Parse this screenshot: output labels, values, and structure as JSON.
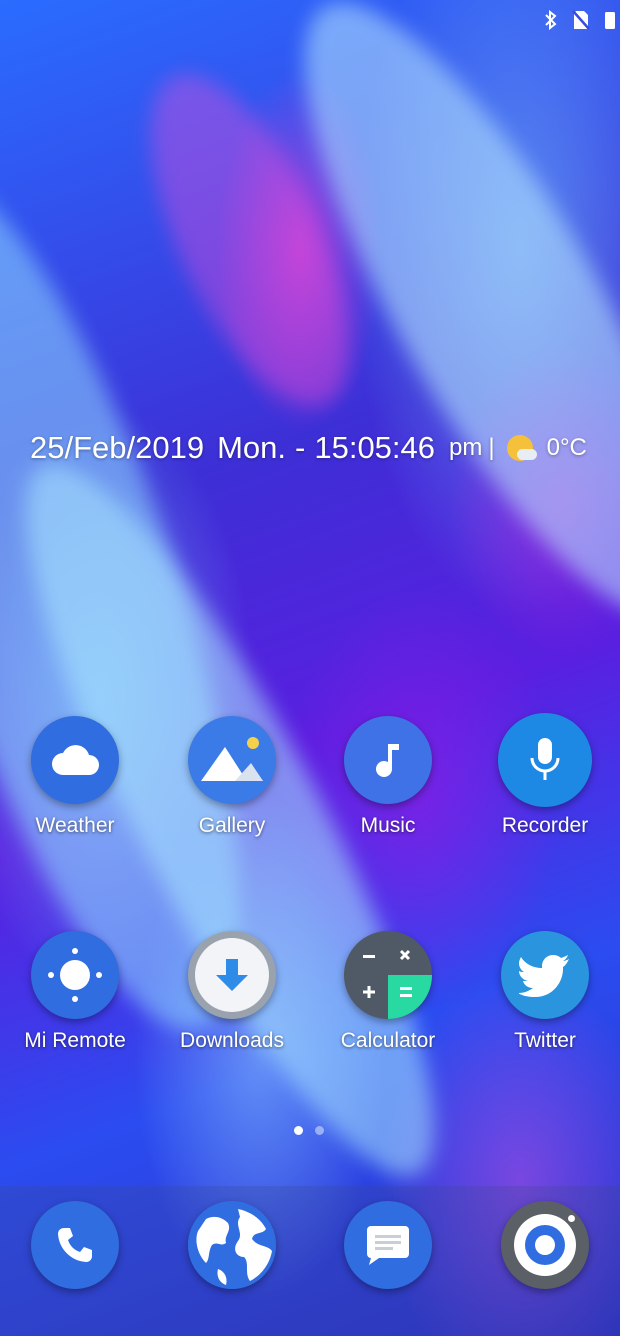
{
  "status_bar": {
    "icons": [
      "bluetooth-icon",
      "no-sim-icon",
      "battery-icon"
    ]
  },
  "clock_widget": {
    "date": "25/Feb/2019",
    "weekday": "Mon.",
    "separator": "-",
    "time": "15:05:46",
    "ampm": "pm",
    "divider": "|",
    "temperature": "0°C",
    "weather_icon": "partly-cloudy-icon"
  },
  "apps": [
    {
      "label": "Weather",
      "icon": "cloud-icon",
      "color": "#2f6de0"
    },
    {
      "label": "Gallery",
      "icon": "mountain-icon",
      "color": "#3a7be8"
    },
    {
      "label": "Music",
      "icon": "music-note-icon",
      "color": "#3f72e6"
    },
    {
      "label": "Recorder",
      "icon": "microphone-icon",
      "color": "#1e88e5"
    },
    {
      "label": "Mi Remote",
      "icon": "remote-icon",
      "color": "#2f6de0"
    },
    {
      "label": "Downloads",
      "icon": "download-arrow-icon",
      "color": "#e9edf2"
    },
    {
      "label": "Calculator",
      "icon": "calculator-icon",
      "color": "#505a66"
    },
    {
      "label": "Twitter",
      "icon": "twitter-bird-icon",
      "color": "#2b94df"
    }
  ],
  "page_indicator": {
    "pages": 2,
    "current": 1
  },
  "dock": [
    {
      "name": "Phone",
      "icon": "phone-icon",
      "color": "#2f6de0"
    },
    {
      "name": "Browser",
      "icon": "globe-icon",
      "color": "#2f6de0"
    },
    {
      "name": "Messages",
      "icon": "message-icon",
      "color": "#2f6de0"
    },
    {
      "name": "Camera",
      "icon": "camera-icon",
      "color": "#5b5f66"
    }
  ]
}
